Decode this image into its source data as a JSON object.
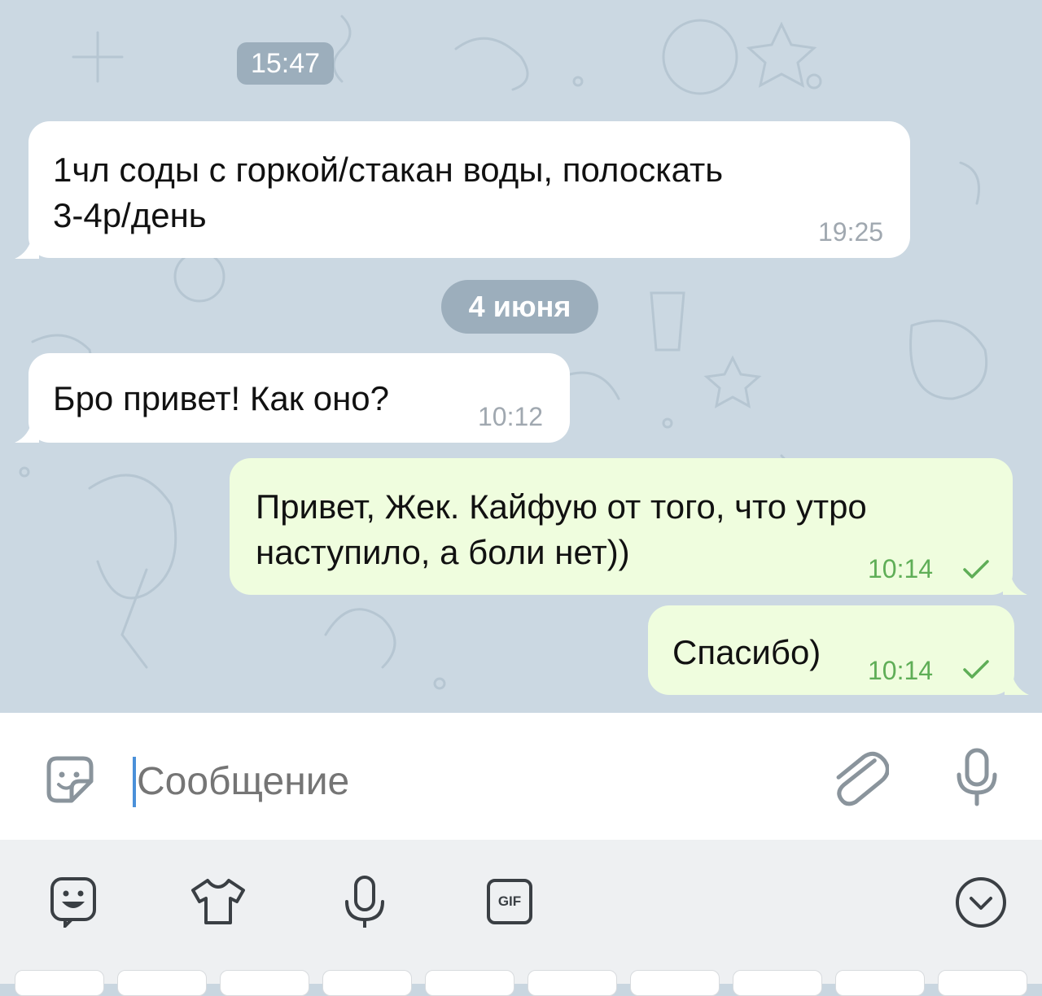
{
  "colors": {
    "chat_background": "#cbd8e2",
    "incoming_bubble": "#ffffff",
    "outgoing_bubble": "#effdde",
    "outgoing_time": "#5fae57",
    "accent": "#4a90d9"
  },
  "chat": {
    "time_separator": "15:47",
    "date_separator": "4 июня",
    "messages": [
      {
        "direction": "incoming",
        "line1": "1чл соды с горкой/стакан воды, полоскать",
        "line2": "3-4р/день",
        "time": "19:25"
      },
      {
        "direction": "incoming",
        "line1": "Бро привет! Как оно?",
        "time": "10:12"
      },
      {
        "direction": "outgoing",
        "line1": "Привет, Жек. Кайфую от того, что утро",
        "line2": "наступило, а боли нет))",
        "time": "10:14",
        "status": "sent-check-icon"
      },
      {
        "direction": "outgoing",
        "line1": "Спасибо)",
        "time": "10:14",
        "status": "sent-check-icon"
      }
    ]
  },
  "composer": {
    "placeholder": "Сообщение",
    "emoji_icon": "sticker-smile-icon",
    "attach_icon": "paperclip-icon",
    "mic_icon": "microphone-icon"
  },
  "keyboard_toolbar": {
    "items": [
      "emoji-icon",
      "tshirt-icon",
      "microphone-icon",
      "gif-icon",
      "chevron-down-circle-icon"
    ],
    "gif_label": "GIF"
  }
}
